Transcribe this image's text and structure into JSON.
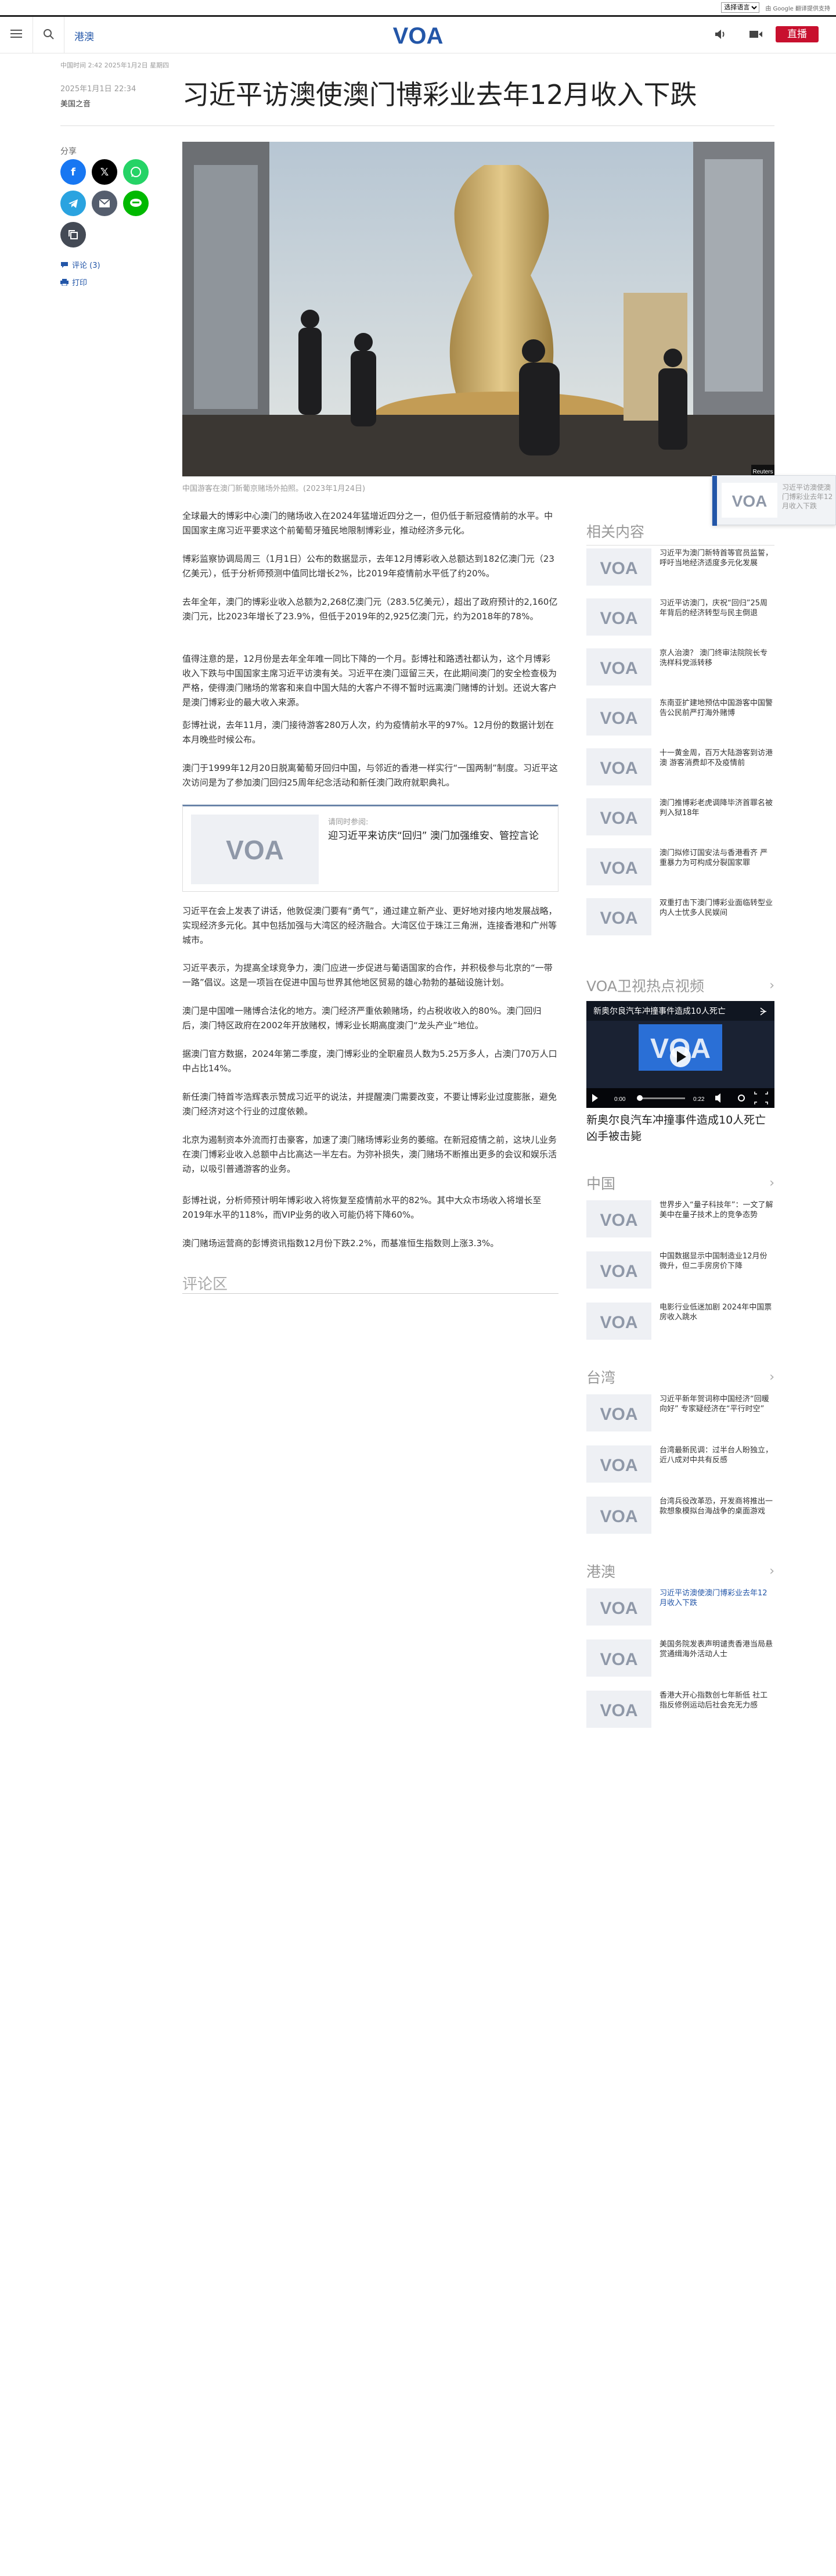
{
  "lang_bar": {
    "select_value": "选择语言",
    "google_translate": "由 Google 翻译提供支持"
  },
  "header": {
    "section_link": "港澳",
    "logo_text": "VOA",
    "live_label": "直播"
  },
  "update_line": "中国时间 2:42 2025年1月2日 星期四",
  "article": {
    "date": "2025年1月1日 22:34",
    "source": "美国之音",
    "title": "习近平访澳使澳门博彩业去年12月收入下跌",
    "share_label": "分享",
    "comments_link": "评论 (3)",
    "print_link": "打印",
    "image_credit": "Reuters",
    "caption": "中国游客在澳门新葡京赌场外拍照。(2023年1月24日)",
    "paragraphs_a": [
      "全球最大的博彩中心澳门的赌场收入在2024年猛增近四分之一，但仍低于新冠疫情前的水平。中国国家主席习近平要求这个前葡萄牙殖民地限制博彩业，推动经济多元化。",
      "博彩监察协调局周三（1月1日）公布的数据显示，去年12月博彩收入总额达到182亿澳门元（23亿美元），低于分析师预测中值同比增长2%，比2019年疫情前水平低了约20%。",
      "去年全年，澳门的博彩业收入总额为2,268亿澳门元（283.5亿美元），超出了政府预计的2,160亿澳门元，比2023年增长了23.9%，但低于2019年的2,925亿澳门元，约为2018年的78%。",
      "值得注意的是，12月份是去年全年唯一同比下降的一个月。彭博社和路透社都认为，这个月博彩收入下跌与中国国家主席习近平访澳有关。习近平在澳门逗留三天，在此期间澳门的安全检查极为严格，使得澳门赌场的常客和来自中国大陆的大客户不得不暂时远离澳门赌博的计划。还说大客户是澳门博彩业的最大收入来源。",
      "彭博社说，去年11月，澳门接待游客280万人次，约为疫情前水平的97%。12月份的数据计划在本月晚些时候公布。",
      "澳门于1999年12月20日脱离葡萄牙回归中国，与邻近的香港一样实行“一国两制”制度。习近平这次访问是为了参加澳门回归25周年纪念活动和新任澳门政府就职典礼。"
    ],
    "related_inline": {
      "kicker": "请同时参阅:",
      "title": "迎习近平来访庆“回归” 澳门加强维安、管控言论"
    },
    "paragraphs_b": [
      "习近平在会上发表了讲话，他敦促澳门要有“勇气”，通过建立新产业、更好地对接内地发展战略，实现经济多元化。其中包括加强与大湾区的经济融合。大湾区位于珠江三角洲，连接香港和广州等城市。",
      "习近平表示，为提高全球竞争力，澳门应进一步促进与葡语国家的合作，并积极参与北京的“一带一路”倡议。这是一项旨在促进中国与世界其他地区贸易的雄心勃勃的基础设施计划。",
      "澳门是中国唯一赌博合法化的地方。澳门经济严重依赖赌场，约占税收收入的80%。澳门回归后，澳门特区政府在2002年开放赌权，博彩业长期高度澳门“龙头产业”地位。",
      "据澳门官方数据，2024年第二季度，澳门博彩业的全职雇员人数为5.25万多人，占澳门70万人口中占比14%。",
      "新任澳门特首岑浩辉表示赞成习近平的说法，并提醒澳门需要改变，不要让博彩业过度膨胀，避免澳门经济对这个行业的过度依赖。",
      "北京为遏制资本外流而打击豪客，加速了澳门赌场博彩业务的萎缩。在新冠疫情之前，这块儿业务在澳门博彩业收入总额中占比高达一半左右。为弥补损失，澳门赌场不断推出更多的会议和娱乐活动，以吸引普通游客的业务。",
      "彭博社说，分析师预计明年博彩收入将恢复至疫情前水平的82%。其中大众市场收入将增长至2019年水平的118%，而VIP业务的收入可能仍将下降60%。",
      "澳门赌场运营商的彭博资讯指数12月份下跌2.2%，而基准恒生指数则上涨3.3%。"
    ],
    "comments_heading": "评论区"
  },
  "sidebar": {
    "related_heading": "相关内容",
    "related": [
      "习近平为澳门新特首等官员监誓，呼吁当地经济适度多元化发展",
      "习近平访澳门，庆祝“回归”25周年背后的经济转型与民主倒退",
      "京人治澳？ 澳门终审法院院长专洗样科党派转移",
      "东南亚扩建地预估中国游客中国警告公民前严打海外赌博",
      "十一黄金周，百万大陆游客到访港澳 游客消费却不及疫情前",
      "澳门推博彩老虎调降毕济首罪名被判入狱18年",
      "澳门拟修订国安法与香港看齐 严重暴力为可构成分裂国家罪",
      "双重打击下澳门博彩业面临转型业内人士忧多人民娱间"
    ],
    "video_heading": "VOA卫视热点视频",
    "video": {
      "overlay_title": "新奥尔良汽车冲撞事件造成10人死亡",
      "time_current": "0:00",
      "time_total": "0:22",
      "title": "新奥尔良汽车冲撞事件造成10人死亡凶手被击毙"
    },
    "china_heading": "中国",
    "china": [
      "世界步入“量子科技年”：一文了解美中在量子技术上的竞争态势",
      "中国数据显示中国制造业12月份微升，但二手房房价下降",
      "电影行业低迷加剧 2024年中国票房收入跳水"
    ],
    "taiwan_heading": "台湾",
    "taiwan": [
      "习近平新年贺词称中国经济“回暖向好” 专家疑经济在“平行时空”",
      "台湾最新民调：过半台人盼独立，近八成对中共有反感",
      "台湾兵役改革恐，开发商将推出一款想象模拟台海战争的桌面游戏"
    ],
    "hk_heading": "港澳",
    "hk": [
      "习近平访澳使澳门博彩业去年12月收入下跌",
      "美国务院发表声明谴责香港当局悬赏通缉海外活动人士",
      "香港大开心指数创七年新低 社工指反修例运动后社会充无力感"
    ]
  },
  "sticky": {
    "text": "习近平访澳使澳门博彩业去年12月收入下跌"
  },
  "colors": {
    "accent_blue": "#2356a8",
    "live_red": "#c8102e",
    "facebook": "#1877f2",
    "x": "#000000",
    "whatsapp": "#25d366",
    "telegram": "#2aa3e0",
    "email": "#555e6e",
    "line": "#00b900",
    "copy": "#444a55"
  }
}
